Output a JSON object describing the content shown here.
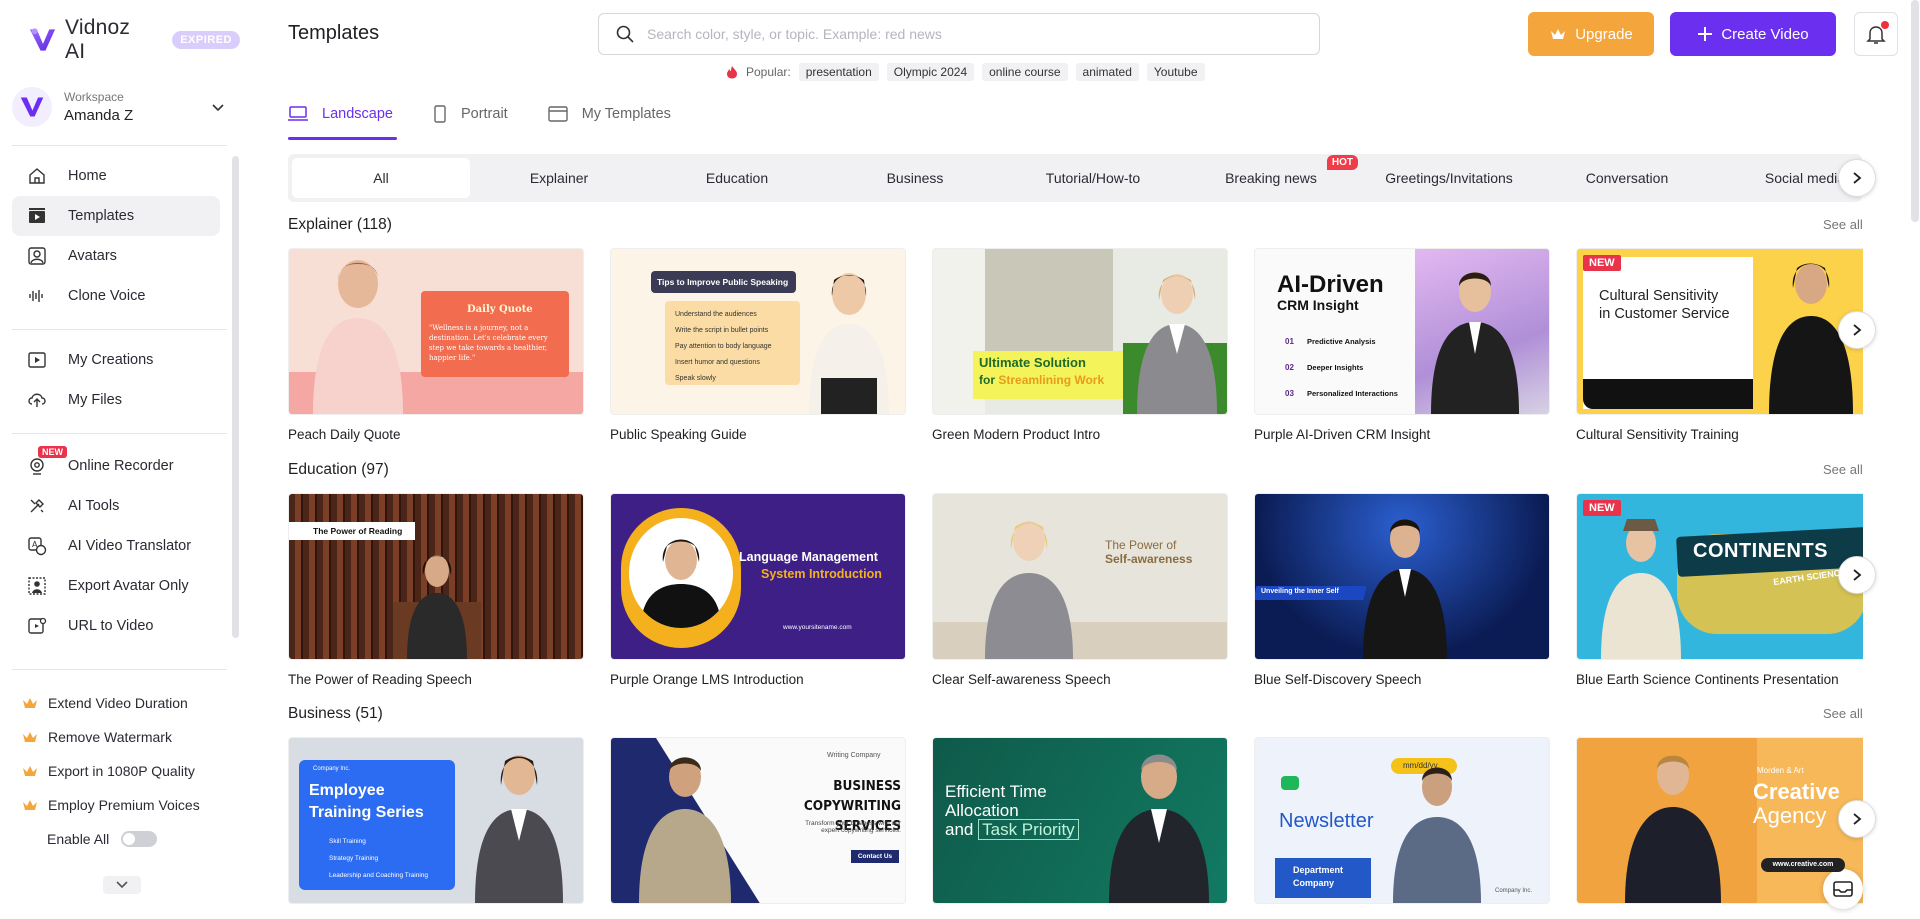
{
  "app": {
    "name": "Vidnoz AI",
    "status_badge": "EXPIRED"
  },
  "workspace": {
    "label": "Workspace",
    "name": "Amanda Z"
  },
  "sidebar": {
    "main_items": [
      {
        "label": "Home",
        "icon": "home-icon"
      },
      {
        "label": "Templates",
        "icon": "templates-icon",
        "active": true
      },
      {
        "label": "Avatars",
        "icon": "avatar-icon"
      },
      {
        "label": "Clone Voice",
        "icon": "voice-wave-icon"
      }
    ],
    "file_items": [
      {
        "label": "My Creations",
        "icon": "play-square-icon"
      },
      {
        "label": "My Files",
        "icon": "upload-cloud-icon"
      }
    ],
    "tool_items": [
      {
        "label": "Online Recorder",
        "icon": "webcam-icon",
        "badge": "NEW"
      },
      {
        "label": "AI Tools",
        "icon": "tools-icon"
      },
      {
        "label": "AI Video Translator",
        "icon": "translate-icon"
      },
      {
        "label": "Export Avatar Only",
        "icon": "export-avatar-icon"
      },
      {
        "label": "URL to Video",
        "icon": "link-video-icon"
      }
    ],
    "premium_items": [
      "Extend Video Duration",
      "Remove Watermark",
      "Export in 1080P Quality",
      "Employ Premium Voices"
    ],
    "enable_all_label": "Enable All",
    "enable_all_on": false
  },
  "header": {
    "title": "Templates",
    "search_placeholder": "Search color, style, or topic. Example: red news",
    "popular_label": "Popular:",
    "popular_tags": [
      "presentation",
      "Olympic 2024",
      "online course",
      "animated",
      "Youtube"
    ],
    "upgrade_label": "Upgrade",
    "create_label": "Create Video"
  },
  "tabs": [
    {
      "label": "Landscape",
      "active": true
    },
    {
      "label": "Portrait"
    },
    {
      "label": "My Templates"
    }
  ],
  "categories": [
    {
      "label": "All",
      "active": true
    },
    {
      "label": "Explainer"
    },
    {
      "label": "Education"
    },
    {
      "label": "Business"
    },
    {
      "label": "Tutorial/How-to"
    },
    {
      "label": "Breaking news",
      "badge": "HOT"
    },
    {
      "label": "Greetings/Invitations"
    },
    {
      "label": "Conversation"
    },
    {
      "label": "Social media"
    }
  ],
  "sections": [
    {
      "title": "Explainer (118)",
      "see_all": "See all",
      "cards": [
        {
          "title": "Peach Daily Quote",
          "overlay": [
            "Daily Quote",
            "\"Wellness is a journey, not a destination. Let's celebrate every step we take towards a healthier, happier life.\""
          ]
        },
        {
          "title": "Public Speaking Guide",
          "overlay": [
            "Tips to Improve Public Speaking",
            "Understand the audiences",
            "Write the script in bullet points",
            "Pay attention to body language",
            "Insert humor and questions",
            "Speak slowly"
          ]
        },
        {
          "title": "Green Modern Product Intro",
          "overlay": [
            "Ultimate Solution",
            "for",
            "Streamlining Work"
          ]
        },
        {
          "title": "Purple AI-Driven CRM Insight",
          "overlay": [
            "AI-Driven",
            "CRM Insight",
            "01",
            "Predictive Analysis",
            "02",
            "Deeper Insights",
            "03",
            "Personalized Interactions"
          ]
        },
        {
          "title": "Cultural Sensitivity Training",
          "badge": "NEW",
          "overlay": [
            "Cultural Sensitivity",
            "in Customer Service"
          ]
        }
      ]
    },
    {
      "title": "Education (97)",
      "see_all": "See all",
      "cards": [
        {
          "title": "The Power of Reading Speech",
          "overlay": [
            "The Power of Reading"
          ]
        },
        {
          "title": "Purple Orange LMS Introduction",
          "overlay": [
            "Language Management",
            "System Introduction",
            "www.yoursitename.com"
          ]
        },
        {
          "title": "Clear Self-awareness Speech",
          "overlay": [
            "The Power of",
            "Self-awareness"
          ]
        },
        {
          "title": "Blue Self-Discovery Speech",
          "overlay": [
            "Unveiling the Inner Self"
          ]
        },
        {
          "title": "Blue Earth Science Continents Presentation",
          "badge": "NEW",
          "overlay": [
            "CONTINENTS",
            "EARTH SCIENCE"
          ]
        }
      ]
    },
    {
      "title": "Business (51)",
      "see_all": "See all",
      "cards": [
        {
          "title": "",
          "overlay": [
            "Company Inc.",
            "Employee",
            "Training Series",
            "Skill Training",
            "Strategy Training",
            "Leadership and Coaching Training"
          ]
        },
        {
          "title": "",
          "overlay": [
            "Writing Company",
            "BUSINESS COPYWRITING",
            "SERVICES",
            "Transform your business with our expert copywriting services.",
            "Contact Us"
          ]
        },
        {
          "title": "",
          "overlay": [
            "Efficient Time",
            "Allocation",
            "and",
            "Task Priority"
          ]
        },
        {
          "title": "",
          "overlay": [
            "mm/dd/yy",
            "Newsletter",
            "Department",
            "Company",
            "Company Inc."
          ]
        },
        {
          "title": "",
          "overlay": [
            "Morden & Art",
            "Creative",
            "Agency",
            "www.creative.com"
          ]
        }
      ]
    }
  ],
  "colors": {
    "brand_purple": "#6b2ff0",
    "upgrade_orange": "#f4a53b",
    "hot_red": "#ef3d4a"
  }
}
